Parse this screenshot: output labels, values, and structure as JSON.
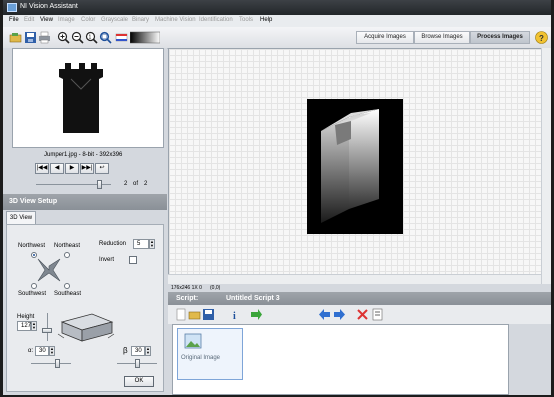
{
  "window": {
    "title": "NI Vision Assistant"
  },
  "menu": [
    {
      "label": "File",
      "enabled": true
    },
    {
      "label": "Edit",
      "enabled": false
    },
    {
      "label": "View",
      "enabled": true
    },
    {
      "label": "Image",
      "enabled": false
    },
    {
      "label": "Color",
      "enabled": false
    },
    {
      "label": "Grayscale",
      "enabled": false
    },
    {
      "label": "Binary",
      "enabled": false
    },
    {
      "label": "Machine Vision",
      "enabled": false
    },
    {
      "label": "Identification",
      "enabled": false
    },
    {
      "label": "Tools",
      "enabled": false
    },
    {
      "label": "Help",
      "enabled": true
    }
  ],
  "toolbar": {
    "icons": [
      "open-icon",
      "save-icon",
      "print-icon",
      "zoom-in-icon",
      "zoom-out-icon",
      "zoom-fit-icon",
      "zoom-1to1-icon",
      "flag-icon",
      "palette-icon"
    ],
    "modes": [
      {
        "label": "Acquire Images",
        "active": false
      },
      {
        "label": "Browse Images",
        "active": false
      },
      {
        "label": "Process Images",
        "active": true
      }
    ],
    "help_label": "?"
  },
  "thumbnail": {
    "caption": "Jumper1.jpg - 8-bit - 392x396",
    "nav_buttons": [
      "|◀◀",
      "◀",
      "▶",
      "▶▶|",
      "↩"
    ],
    "page_current": "2",
    "page_of": "of",
    "page_total": "2"
  },
  "setup": {
    "title": "3D View Setup",
    "tab": "3D View",
    "directions": {
      "northwest": "Northwest",
      "northeast": "Northeast",
      "southwest": "Southwest",
      "southeast": "Southeast",
      "selected": "Northwest"
    },
    "reduction_label": "Reduction",
    "reduction_value": "5",
    "invert_label": "Invert",
    "invert_checked": false,
    "height_label": "Height",
    "height_value": "127",
    "alpha_label": "α:",
    "alpha_value": "30",
    "beta_label": "β",
    "beta_value": "30",
    "ok_label": "OK"
  },
  "viewer": {
    "status_size": "176x246 1X 0",
    "status_coords": "(0,0)"
  },
  "script": {
    "header_label": "Script:",
    "name": "Untitled Script 3",
    "step_label": "Original Image"
  },
  "colors": {
    "accent_blue": "#1d4f9a",
    "section_gray": "#8a9097",
    "viewer_bg": "#f7f7f7"
  }
}
